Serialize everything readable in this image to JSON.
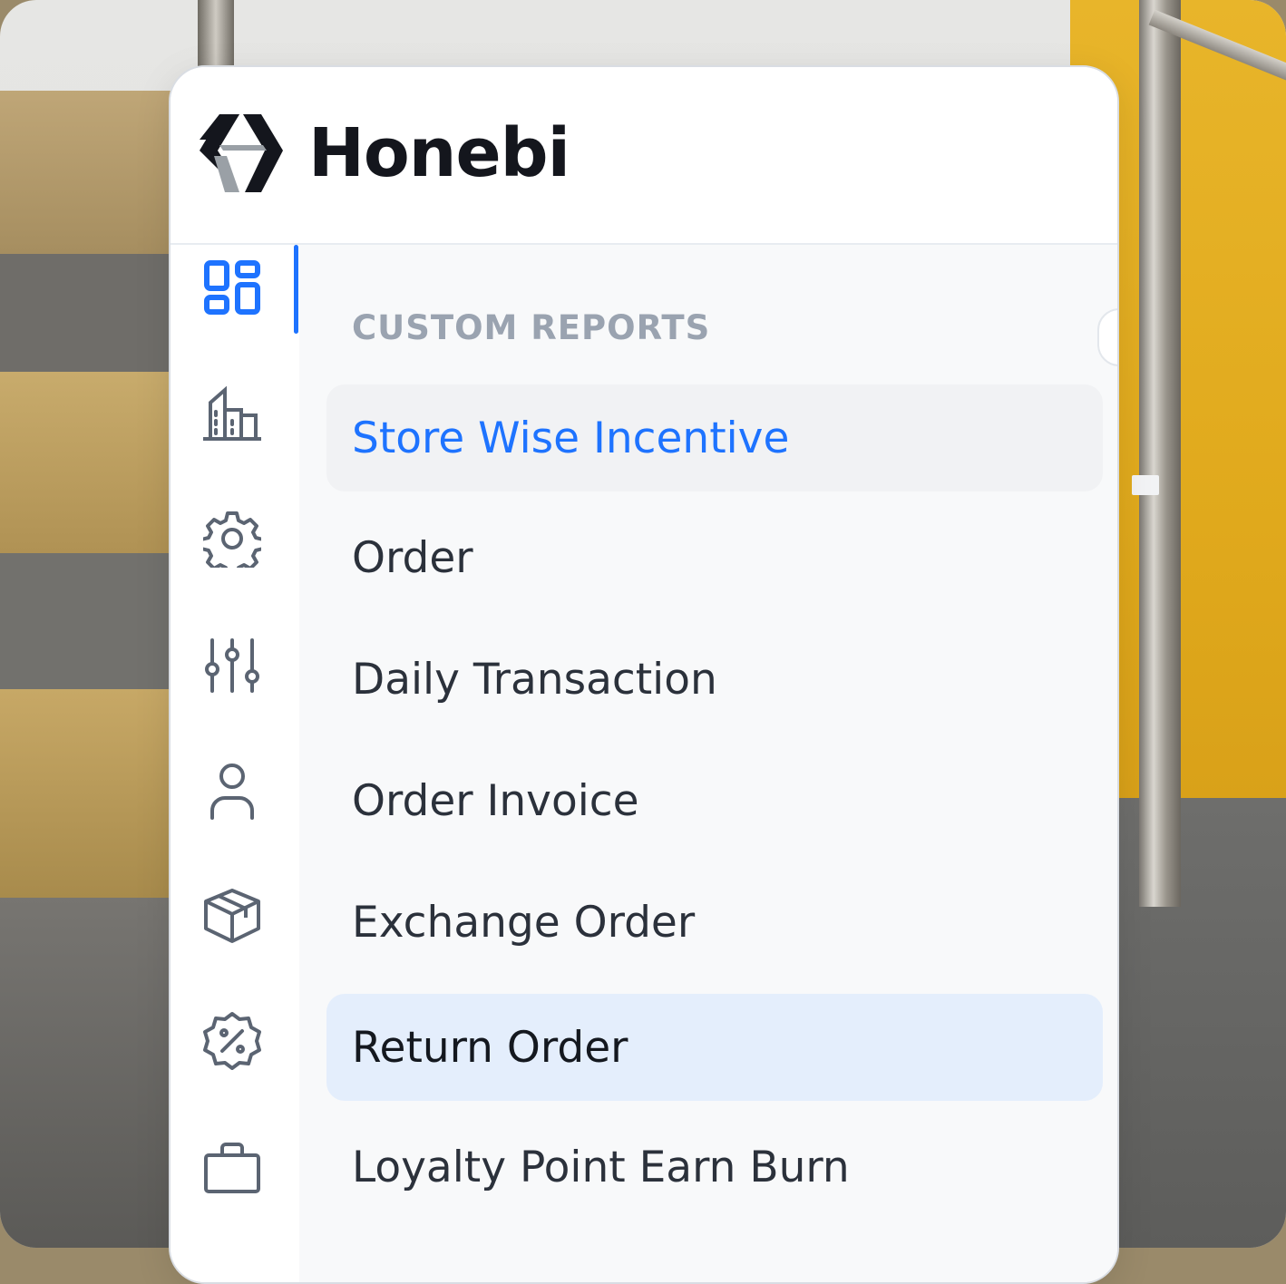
{
  "brand": {
    "name": "Honebi"
  },
  "colors": {
    "accent": "#1e73ff",
    "icon": "#5b6472",
    "text": "#2b313b",
    "section_title": "#9aa3b0",
    "active_bg": "#f1f2f4",
    "hover_bg": "#e4eefc"
  },
  "rail": {
    "items": [
      {
        "icon": "dashboard-grid-icon",
        "active": true
      },
      {
        "icon": "buildings-icon",
        "active": false
      },
      {
        "icon": "gear-icon",
        "active": false
      },
      {
        "icon": "sliders-icon",
        "active": false
      },
      {
        "icon": "user-icon",
        "active": false
      },
      {
        "icon": "box-icon",
        "active": false
      },
      {
        "icon": "discount-badge-icon",
        "active": false
      },
      {
        "icon": "shopping-bag-icon",
        "active": false
      }
    ]
  },
  "menu": {
    "section_title": "CUSTOM REPORTS",
    "items": [
      {
        "label": "Store Wise Incentive",
        "state": "active"
      },
      {
        "label": "Order",
        "state": "normal"
      },
      {
        "label": "Daily Transaction",
        "state": "normal"
      },
      {
        "label": "Order Invoice",
        "state": "normal"
      },
      {
        "label": "Exchange Order",
        "state": "normal"
      },
      {
        "label": "Return Order",
        "state": "hover"
      },
      {
        "label": "Loyalty Point Earn Burn",
        "state": "normal"
      }
    ]
  }
}
